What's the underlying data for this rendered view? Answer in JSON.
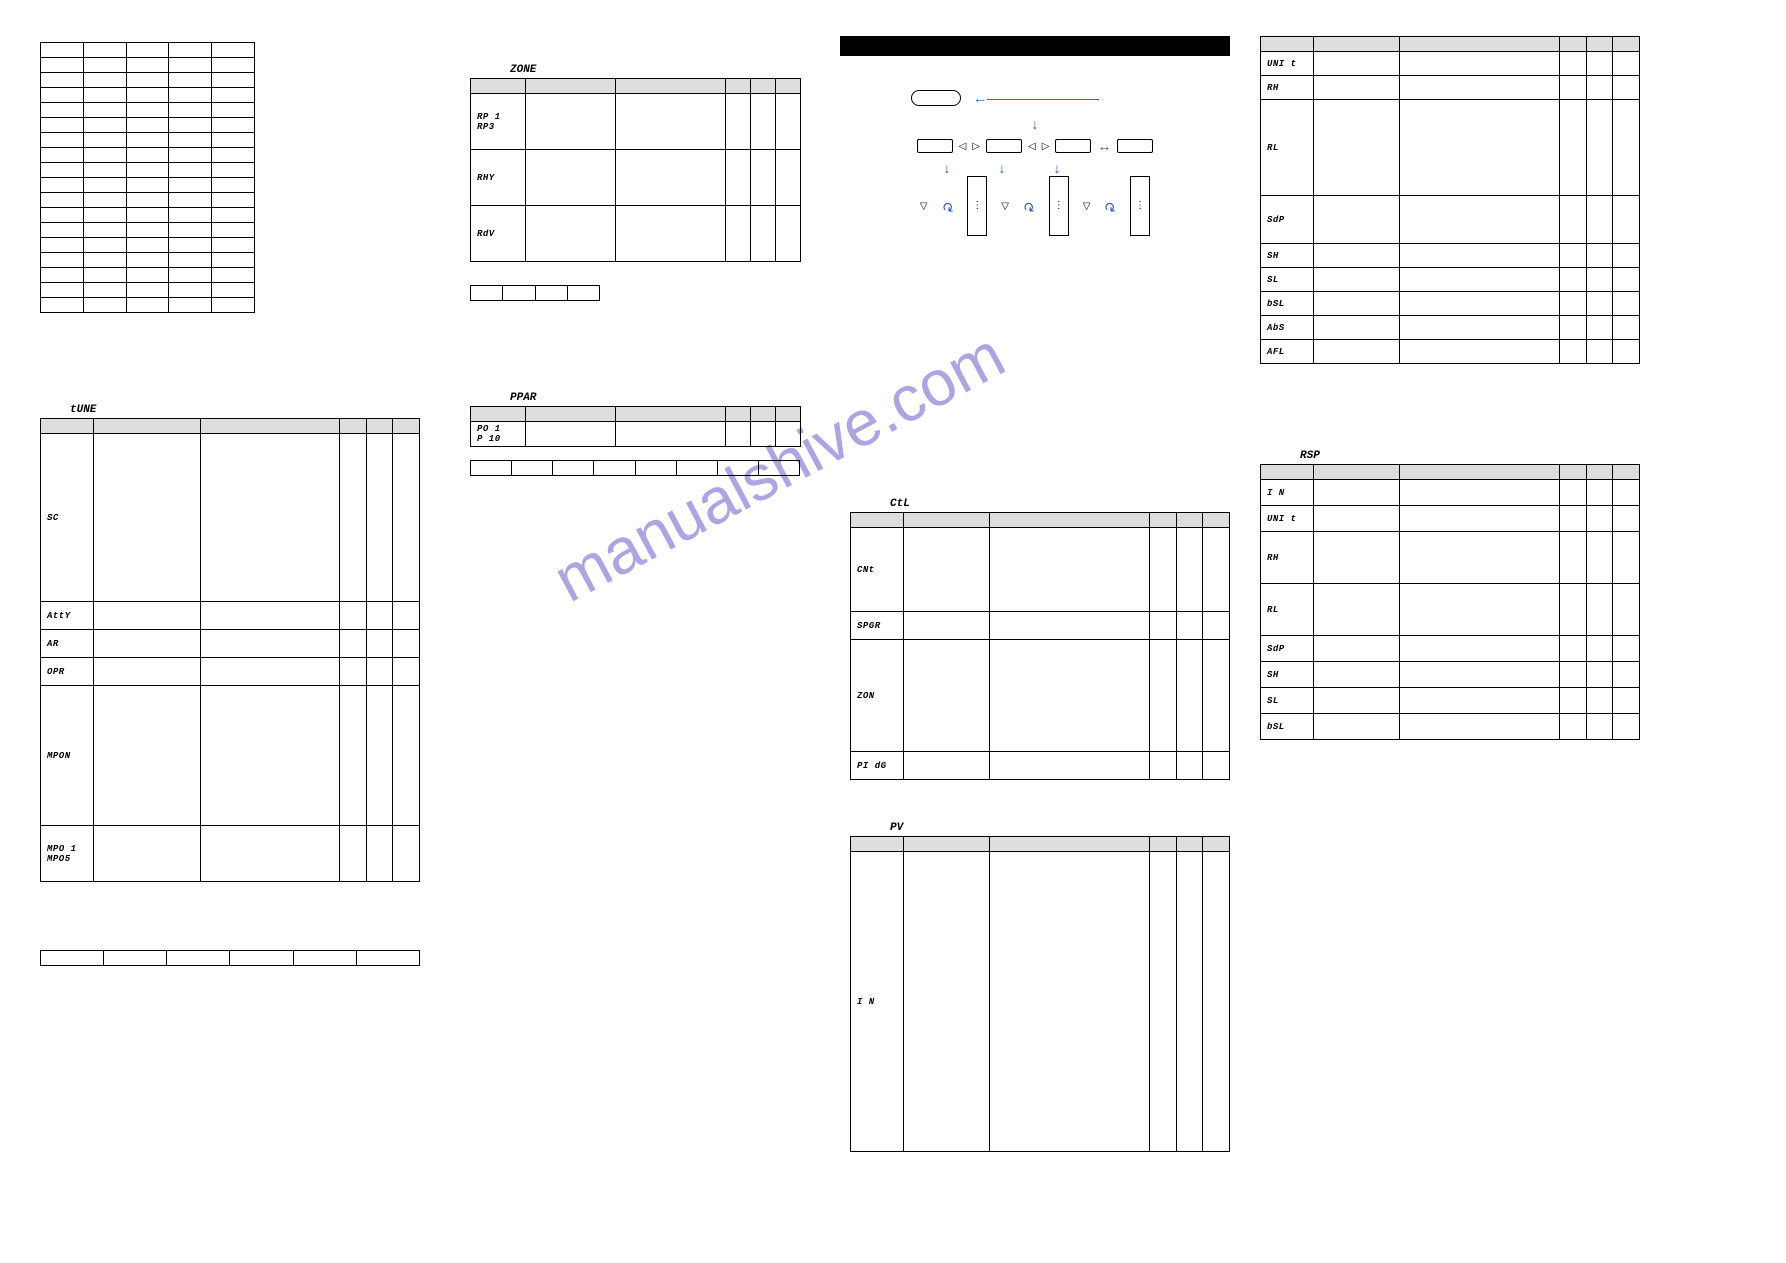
{
  "watermark": "manualshive.com",
  "captions": {
    "tune": "tUNE",
    "zone": "ZONE",
    "ppar": "PPAR",
    "ctl": "CtL",
    "pv": "PV",
    "rsp": "RSP"
  },
  "plain_table": {
    "rows": 18,
    "cols": 5
  },
  "tune": {
    "head_cols": 6,
    "rows": [
      {
        "c0": "SC",
        "h": 6
      },
      {
        "c0": "AttY",
        "h": 1
      },
      {
        "c0": "AR",
        "h": 1
      },
      {
        "c0": "OPR",
        "h": 1
      },
      {
        "c0": "MPON",
        "h": 5
      },
      {
        "c0": "MPO 1\nMPO5",
        "h": 2
      }
    ],
    "strip_cols": 6
  },
  "zone": {
    "rows": [
      {
        "c0": "RP 1\n RP3",
        "h": 2
      },
      {
        "c0": "RHY",
        "h": 2
      },
      {
        "c0": "RdV",
        "h": 2
      }
    ],
    "strip_cols": 4
  },
  "ppar": {
    "rows": [
      {
        "c0": "PO 1\nP 10",
        "h": 2
      }
    ],
    "strip_cols": 8
  },
  "ctl": {
    "rows": [
      {
        "c0": "CNt",
        "h": 3
      },
      {
        "c0": "SPGR",
        "h": 1
      },
      {
        "c0": "ZON",
        "h": 4
      },
      {
        "c0": "PI dG",
        "h": 1
      }
    ]
  },
  "pv": {
    "rows": [
      {
        "c0": "I N",
        "h": 10
      }
    ]
  },
  "right_top": {
    "rows": [
      {
        "c0": "UNI t",
        "h": 1
      },
      {
        "c0": "RH",
        "h": 1
      },
      {
        "c0": "RL",
        "h": 4
      },
      {
        "c0": "SdP",
        "h": 2
      },
      {
        "c0": "SH",
        "h": 1
      },
      {
        "c0": "SL",
        "h": 1
      },
      {
        "c0": "bSL",
        "h": 1
      },
      {
        "c0": "AbS",
        "h": 1
      },
      {
        "c0": "AFL",
        "h": 1
      }
    ]
  },
  "rsp": {
    "rows": [
      {
        "c0": "I N",
        "h": 1
      },
      {
        "c0": "UNI t",
        "h": 1
      },
      {
        "c0": "RH",
        "h": 2
      },
      {
        "c0": "RL",
        "h": 2
      },
      {
        "c0": "SdP",
        "h": 1
      },
      {
        "c0": "SH",
        "h": 1
      },
      {
        "c0": "SL",
        "h": 1
      },
      {
        "c0": "bSL",
        "h": 1
      }
    ]
  },
  "flow": {
    "top": "round",
    "row2": [
      "box",
      "box",
      "box",
      "box"
    ],
    "cols": 3
  },
  "chart_data": {
    "type": "table",
    "title": "",
    "note": "Scanned manual parameter-map page; no numeric chart present."
  }
}
